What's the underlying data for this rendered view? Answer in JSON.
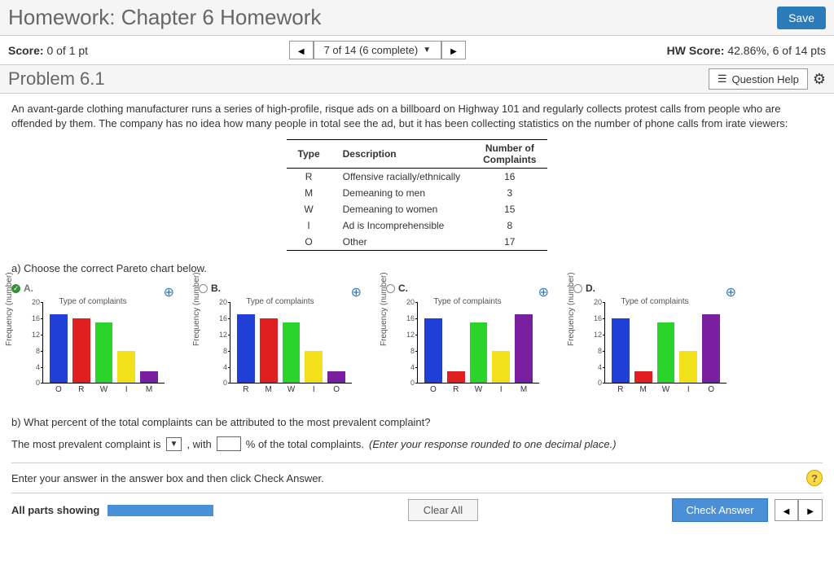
{
  "header": {
    "title": "Homework: Chapter 6 Homework",
    "save": "Save"
  },
  "subheader": {
    "score_label": "Score:",
    "score_value": "0 of 1 pt",
    "nav_text": "7 of 14 (6 complete)",
    "hw_label": "HW Score:",
    "hw_value": "42.86%, 6 of 14 pts"
  },
  "problem": {
    "title": "Problem 6.1",
    "help": "Question Help"
  },
  "prose": "An avant-garde clothing manufacturer runs a series of high-profile, risque ads on a billboard on Highway 101 and regularly collects protest calls from people who are offended by them. The company has no idea how many people in total see the ad, but it has been collecting statistics on the number of phone calls from irate viewers:",
  "table": {
    "headers": [
      "Type",
      "Description",
      "Number of Complaints"
    ],
    "rows": [
      {
        "type": "R",
        "desc": "Offensive racially/ethnically",
        "n": 16
      },
      {
        "type": "M",
        "desc": "Demeaning to men",
        "n": 3
      },
      {
        "type": "W",
        "desc": "Demeaning to women",
        "n": 15
      },
      {
        "type": "I",
        "desc": "Ad is Incomprehensible",
        "n": 8
      },
      {
        "type": "O",
        "desc": "Other",
        "n": 17
      }
    ]
  },
  "part_a": "a) Choose the correct Pareto chart below.",
  "options": {
    "labels": [
      "A.",
      "B.",
      "C.",
      "D."
    ],
    "selected": 0,
    "ylabel": "Frequency (number)",
    "xlabel": "Type of complaints",
    "yticks": [
      0,
      4,
      8,
      12,
      16,
      20
    ]
  },
  "chart_data": [
    {
      "type": "bar",
      "option": "A",
      "categories": [
        "O",
        "R",
        "W",
        "I",
        "M"
      ],
      "values": [
        17,
        16,
        15,
        8,
        3
      ],
      "colors": [
        "#1f3fd6",
        "#e02020",
        "#2bd42b",
        "#f2e01a",
        "#7a1fa0"
      ],
      "ylim": [
        0,
        20
      ],
      "ylabel": "Frequency (number)",
      "xlabel": "Type of complaints"
    },
    {
      "type": "bar",
      "option": "B",
      "categories": [
        "R",
        "M",
        "W",
        "I",
        "O"
      ],
      "values": [
        17,
        16,
        15,
        8,
        3
      ],
      "colors": [
        "#1f3fd6",
        "#e02020",
        "#2bd42b",
        "#f2e01a",
        "#7a1fa0"
      ],
      "ylim": [
        0,
        20
      ],
      "ylabel": "Frequency (number)",
      "xlabel": "Type of complaints"
    },
    {
      "type": "bar",
      "option": "C",
      "categories": [
        "O",
        "R",
        "W",
        "I",
        "M"
      ],
      "values": [
        16,
        3,
        15,
        8,
        17
      ],
      "colors": [
        "#1f3fd6",
        "#e02020",
        "#2bd42b",
        "#f2e01a",
        "#7a1fa0"
      ],
      "ylim": [
        0,
        20
      ],
      "ylabel": "Frequency (number)",
      "xlabel": "Type of complaints"
    },
    {
      "type": "bar",
      "option": "D",
      "categories": [
        "R",
        "M",
        "W",
        "I",
        "O"
      ],
      "values": [
        16,
        3,
        15,
        8,
        17
      ],
      "colors": [
        "#1f3fd6",
        "#e02020",
        "#2bd42b",
        "#f2e01a",
        "#7a1fa0"
      ],
      "ylim": [
        0,
        20
      ],
      "ylabel": "Frequency (number)",
      "xlabel": "Type of complaints"
    }
  ],
  "part_b": "b) What percent of the total complaints can be attributed to the most prevalent complaint?",
  "answer_line": {
    "pre": "The most prevalent complaint is",
    "mid": ", with",
    "post": "% of the total complaints.",
    "hint": "(Enter your response rounded to one decimal place.)"
  },
  "footer": {
    "instruction": "Enter your answer in the answer box and then click Check Answer.",
    "parts": "All parts showing",
    "progress_pct": 100,
    "clear": "Clear All",
    "check": "Check Answer"
  }
}
